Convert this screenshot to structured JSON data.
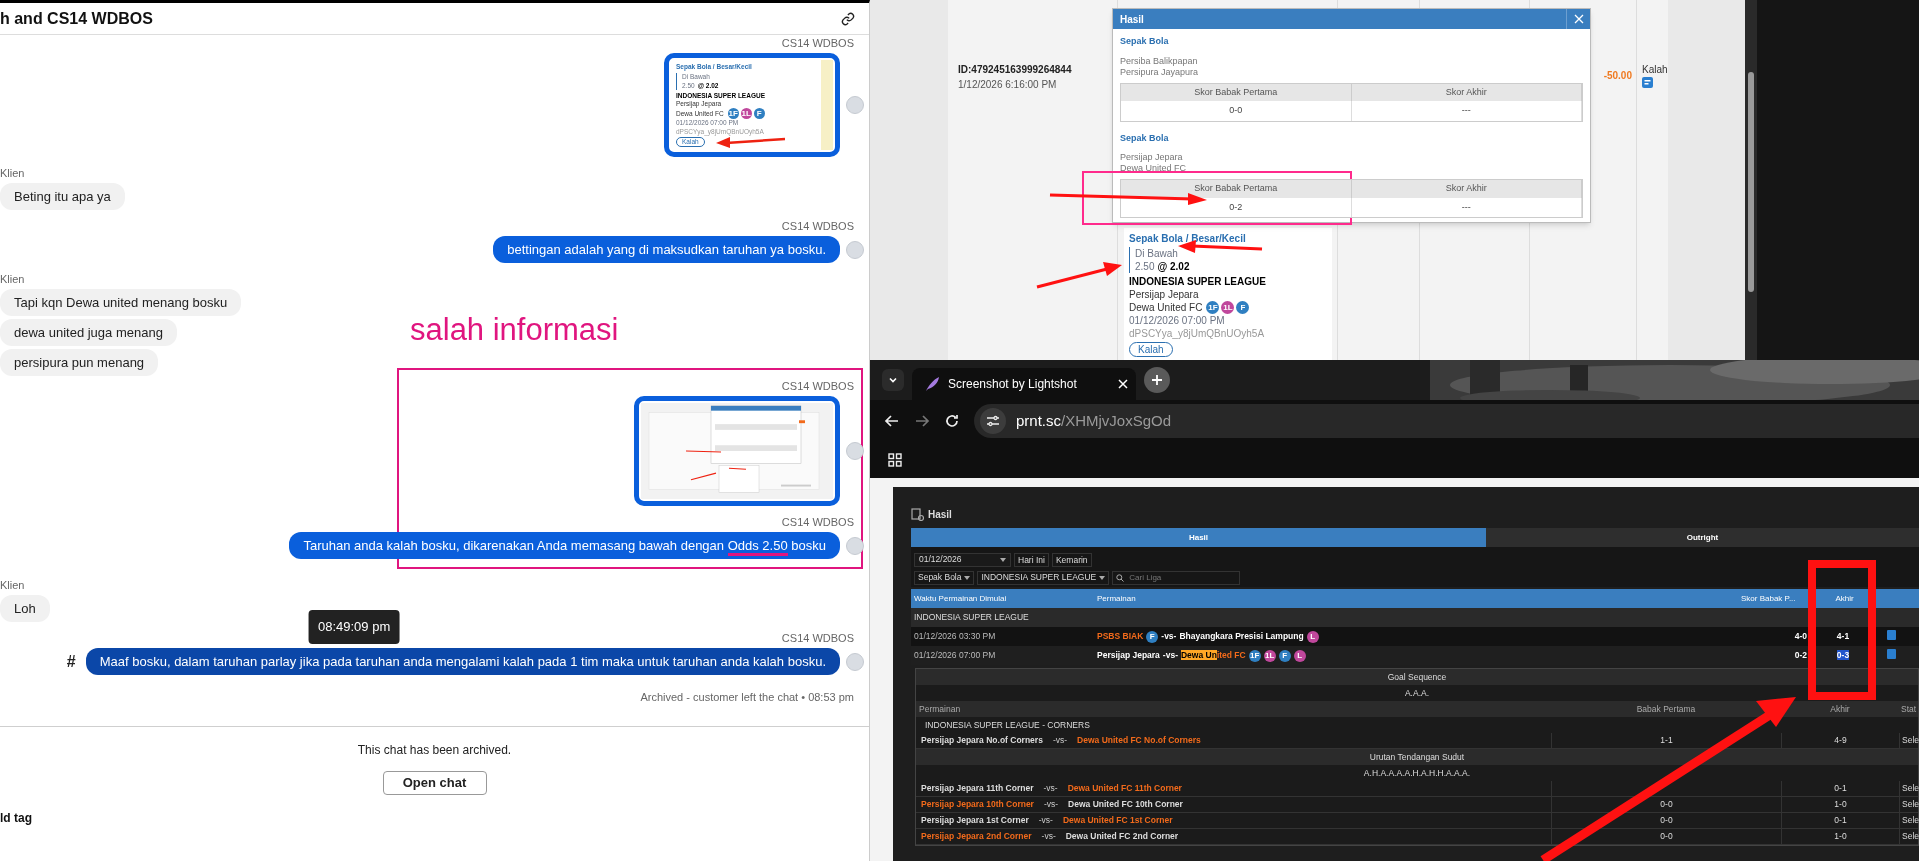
{
  "chat": {
    "title": "h and CS14 WDBOS",
    "messages": [
      {
        "sender": "CS14 WDBOS",
        "kind": "agent_slip",
        "annotated": false,
        "slip": {
          "market": "Sepak Bola / Besar/Kecil",
          "pick": "Di Bawah",
          "line": "2.50",
          "odds": "@ 2.02",
          "league": "INDONESIA SUPER LEAGUE",
          "home": "Persijap Jepara",
          "away": "Dewa United FC",
          "badges": [
            {
              "text": "1F",
              "color": "#2f7fc1"
            },
            {
              "text": "1L",
              "color": "#c0479c"
            },
            {
              "text": "F",
              "color": "#2f7fc1"
            }
          ],
          "date": "01/12/2026 07:00 PM",
          "ref": "dPSCYya_y8jUmQBnUOyh5A",
          "status": "Kalah"
        }
      },
      {
        "sender": "Klien",
        "kind": "client_text",
        "annotated": false,
        "hovered": false,
        "text": "Beting itu apa ya"
      },
      {
        "sender": "CS14 WDBOS",
        "kind": "agent_text",
        "annotated": false,
        "hovered": false,
        "text": "bettingan adalah yang di maksudkan taruhan ya bosku."
      },
      {
        "sender": "Klien",
        "kind": "client_text",
        "annotated": false,
        "hovered": false,
        "text": "Tapi kqn Dewa united menang bosku"
      },
      {
        "kind": "client_text",
        "annotated": false,
        "hovered": false,
        "text": "dewa united juga menang"
      },
      {
        "kind": "client_text",
        "annotated": false,
        "hovered": false,
        "text": "persipura pun menang"
      },
      {
        "sender": "CS14 WDBOS",
        "kind": "agent_screenshot",
        "annotated": true
      },
      {
        "sender": "CS14 WDBOS",
        "kind": "agent_text",
        "annotated": true,
        "hovered": false,
        "text": "Taruhan anda kalah bosku, dikarenakan Anda memasang bawah dengan ",
        "marked": "Odds 2.50",
        "text_after": " bosku"
      },
      {
        "sender": "Klien",
        "kind": "client_text",
        "annotated": false,
        "hovered": false,
        "text": "Loh"
      },
      {
        "sender": "CS14 WDBOS",
        "kind": "agent_text",
        "annotated": false,
        "hovered": true,
        "tooltip": "08:49:09 pm",
        "hover_mark": "#",
        "text": "Maaf bosku, dalam taruhan parlay jika pada taruhan anda mengalami kalah pada 1 tim maka untuk taruhan anda kalah bosku."
      }
    ],
    "status_note": "Archived - customer left the chat • 08:53 pm",
    "archived_text": "This chat has been archived.",
    "open_button": "Open chat",
    "tag_label": "ld tag"
  },
  "annotation_text": "salah informasi",
  "bet_history": {
    "bet_id": "ID:479245163999264844",
    "placed": "1/12/2026 6:16:00 PM",
    "amount": "-50.00",
    "result": "Kalah",
    "slip": {
      "market": "Sepak Bola / Besar/Kecil",
      "pick": "Di Bawah",
      "line": "2.50",
      "odds": "@ 2.02",
      "league": "INDONESIA SUPER LEAGUE",
      "home": "Persijap Jepara",
      "away": "Dewa United FC",
      "badges": [
        {
          "text": "1F",
          "color": "#2f7fc1"
        },
        {
          "text": "1L",
          "color": "#c0479c"
        },
        {
          "text": "F",
          "color": "#2f7fc1"
        }
      ],
      "date": "01/12/2026 07:00 PM",
      "ref": "dPSCYya_y8jUmQBnUOyh5A",
      "status": "Kalah"
    },
    "modal": {
      "title": "Hasil",
      "sections": [
        {
          "sport": "Sepak Bola",
          "teams": [
            "Persiba Balikpapan",
            "Persipura Jayapura"
          ],
          "columns": [
            "Skor Babak Pertama",
            "Skor Akhir"
          ],
          "values": [
            "0-0",
            "---"
          ],
          "annotated": false
        },
        {
          "sport": "Sepak Bola",
          "teams": [
            "Persijap Jepara",
            "Dewa United FC"
          ],
          "columns": [
            "Skor Babak Pertama",
            "Skor Akhir"
          ],
          "values": [
            "0-2",
            "---"
          ],
          "annotated": true
        }
      ]
    }
  },
  "browser": {
    "tab_title": "Screenshot by Lightshot",
    "url_host": "prnt.sc",
    "url_path": "/XHMjvJoxSgOd",
    "page": {
      "title": "Hasil",
      "tabs": [
        {
          "label": "Hasil",
          "selected": true
        },
        {
          "label": "Outright",
          "selected": false
        }
      ],
      "date": "01/12/2026",
      "today": "Hari Ini",
      "yesterday": "Kemarin",
      "sport": "Sepak Bola",
      "league": "INDONESIA SUPER LEAGUE",
      "search_placeholder": "Cari Liga",
      "columns": [
        "Waktu Permainan Dimulai",
        "Permainan",
        "Skor Babak P...",
        "Akhir"
      ],
      "league_row": "INDONESIA SUPER LEAGUE",
      "matches": [
        {
          "time": "01/12/2026 03:30 PM",
          "home_won": true,
          "away_won": false,
          "home": [
            {
              "text": "PSBS BIAK",
              "selected": false
            }
          ],
          "home_badges": [
            {
              "text": "F",
              "color": "#2f7fc1"
            }
          ],
          "vs": "-vs-",
          "away": [
            {
              "text": "Bhayangkara Presisi Lampung",
              "selected": false
            }
          ],
          "away_badges": [
            {
              "text": "L",
              "color": "#c0479c"
            }
          ],
          "half": "4-0",
          "final": "4-1",
          "final_selected": false
        },
        {
          "time": "01/12/2026 07:00 PM",
          "home_won": false,
          "away_won": true,
          "home": [
            {
              "text": "Persijap Jepara",
              "selected": false
            }
          ],
          "vs": "-vs-",
          "away": [
            {
              "text": "Dewa Un",
              "selected": true
            },
            {
              "text": "ited FC",
              "selected": false
            }
          ],
          "away_badges": [
            {
              "text": "1F",
              "color": "#2f7fc1"
            },
            {
              "text": "1L",
              "color": "#c0479c"
            },
            {
              "text": "F",
              "color": "#2f7fc1"
            },
            {
              "text": "L",
              "color": "#c0479c"
            }
          ],
          "half": "0-2",
          "final": "0-3",
          "final_selected": true
        }
      ],
      "detail": {
        "goal_title": "Goal Sequence",
        "goal_sequence": "A.A.A.",
        "columns": [
          "Permainan",
          "Babak Pertama",
          "Akhir",
          "Stat"
        ],
        "group": "INDONESIA SUPER LEAGUE - CORNERS",
        "total": {
          "home": "Persijap Jepara No.of Corners",
          "vs": "-vs-",
          "away": "Dewa United FC No.of Corners",
          "home_won": false,
          "away_won": true,
          "half": "1-1",
          "final": "4-9",
          "status": "Sele"
        },
        "corner_title": "Urutan Tendangan Sudut",
        "corner_sequence": "A.H.A.A.A.A.H.A.H.H.A.A.A.",
        "corners": [
          {
            "home": "Persijap Jepara 11th Corner",
            "vs": "-vs-",
            "away": "Dewa United FC 11th Corner",
            "home_won": false,
            "away_won": true,
            "final": "0-1",
            "status": "Sele"
          },
          {
            "home": "Persijap Jepara 10th Corner",
            "vs": "-vs-",
            "away": "Dewa United FC 10th Corner",
            "home_won": true,
            "away_won": false,
            "half": "0-0",
            "final": "1-0",
            "status": "Sele"
          },
          {
            "home": "Persijap Jepara 1st Corner",
            "vs": "-vs-",
            "away": "Dewa United FC 1st Corner",
            "home_won": false,
            "away_won": true,
            "half": "0-0",
            "final": "0-1",
            "status": "Sele"
          },
          {
            "home": "Persijap Jepara 2nd Corner",
            "vs": "-vs-",
            "away": "Dewa United FC 2nd Corner",
            "home_won": true,
            "away_won": false,
            "half": "0-0",
            "final": "1-0",
            "status": "Sele"
          }
        ]
      }
    }
  }
}
